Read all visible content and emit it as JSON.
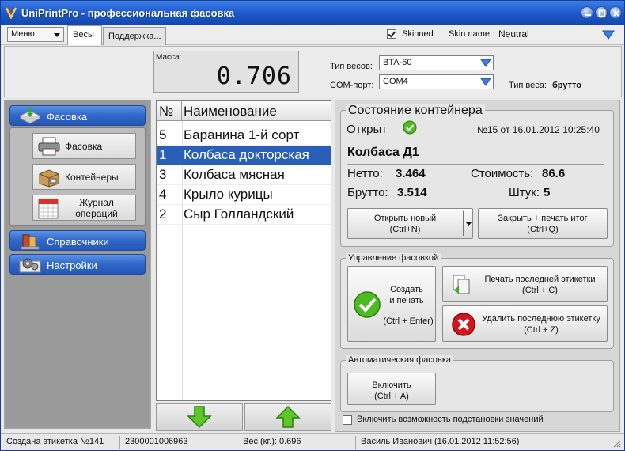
{
  "window": {
    "title": "UniPrintPro - профессиональная фасовка"
  },
  "menubar": {
    "menu_label": "Меню",
    "tabs": [
      {
        "label": "Весы"
      },
      {
        "label": "Поддержка..."
      }
    ],
    "skinned_label": "Skinned",
    "skinned_checked": true,
    "skin_name_label": "Skin name :",
    "skin_name_value": "Neutral"
  },
  "scale": {
    "mass_label": "Масса:",
    "mass_value": "0.706",
    "scale_type_label": "Тип весов:",
    "scale_type_value": "BTA-60",
    "com_port_label": "COM-порт:",
    "com_port_value": "COM4",
    "weight_type_label": "Тип веса:",
    "weight_type_value": "брутто"
  },
  "nav": {
    "sections": [
      {
        "label": "Фасовка",
        "icon": "packing-icon"
      },
      {
        "label": "Справочники",
        "icon": "books-icon"
      },
      {
        "label": "Настройки",
        "icon": "settings-gears-icon"
      }
    ],
    "items": [
      {
        "label": "Фасовка",
        "icon": "printer-icon"
      },
      {
        "label": "Контейнеры",
        "icon": "container-box-icon"
      },
      {
        "label_line1": "Журнал",
        "label_line2": "операций",
        "icon": "calendar-log-icon"
      }
    ]
  },
  "product_list": {
    "col_num": "№",
    "col_name": "Наименование",
    "rows": [
      {
        "num": "5",
        "name": "Баранина 1-й сорт",
        "selected": false
      },
      {
        "num": "1",
        "name": "Колбаса докторская",
        "selected": true
      },
      {
        "num": "3",
        "name": "Колбаса мясная",
        "selected": false
      },
      {
        "num": "4",
        "name": "Крыло курицы",
        "selected": false
      },
      {
        "num": "2",
        "name": "Сыр Голландский",
        "selected": false
      }
    ]
  },
  "container": {
    "title": "Состояние контейнера",
    "state": "Открыт",
    "number_date": "№15 от 16.01.2012 10:25:40",
    "name": "Колбаса Д1",
    "net_label": "Нетто:",
    "net_value": "3.464",
    "cost_label": "Стоимость:",
    "cost_value": "86.6",
    "gross_label": "Брутто:",
    "gross_value": "3.514",
    "count_label": "Штук:",
    "count_value": "5",
    "open_new_line1": "Открыть новый",
    "open_new_line2": "(Ctrl+N)",
    "close_print_line1": "Закрыть + печать итог",
    "close_print_line2": "(Ctrl+Q)"
  },
  "packing": {
    "title": "Управление фасовкой",
    "create_line1": "Создать",
    "create_line2": "и печать",
    "create_line3": "(Ctrl + Enter)",
    "print_last_line1": "Печать последней этикетки",
    "print_last_line2": "(Ctrl + C)",
    "delete_last_line1": "Удалить последнюю этикетку",
    "delete_last_line2": "(Ctrl + Z)"
  },
  "auto": {
    "title": "Автоматическая фасовка",
    "enable_line1": "Включить",
    "enable_line2": "(Ctrl + A)",
    "substitute_label": "Включить возможность подстановки значений",
    "substitute_checked": false
  },
  "status": {
    "label_created": "Создана этикетка №141",
    "barcode": "2300001006963",
    "weight": "Вес (кг.): 0.696",
    "user_time": "Василь Иванович (16.01.2012 11:52:56)"
  },
  "colors": {
    "title_blue": "#1c58c8",
    "selection_blue": "#2a5fb8",
    "nav_blue": "#2f66c8",
    "ok_green": "#3fae1c",
    "delete_red": "#d4151b"
  }
}
